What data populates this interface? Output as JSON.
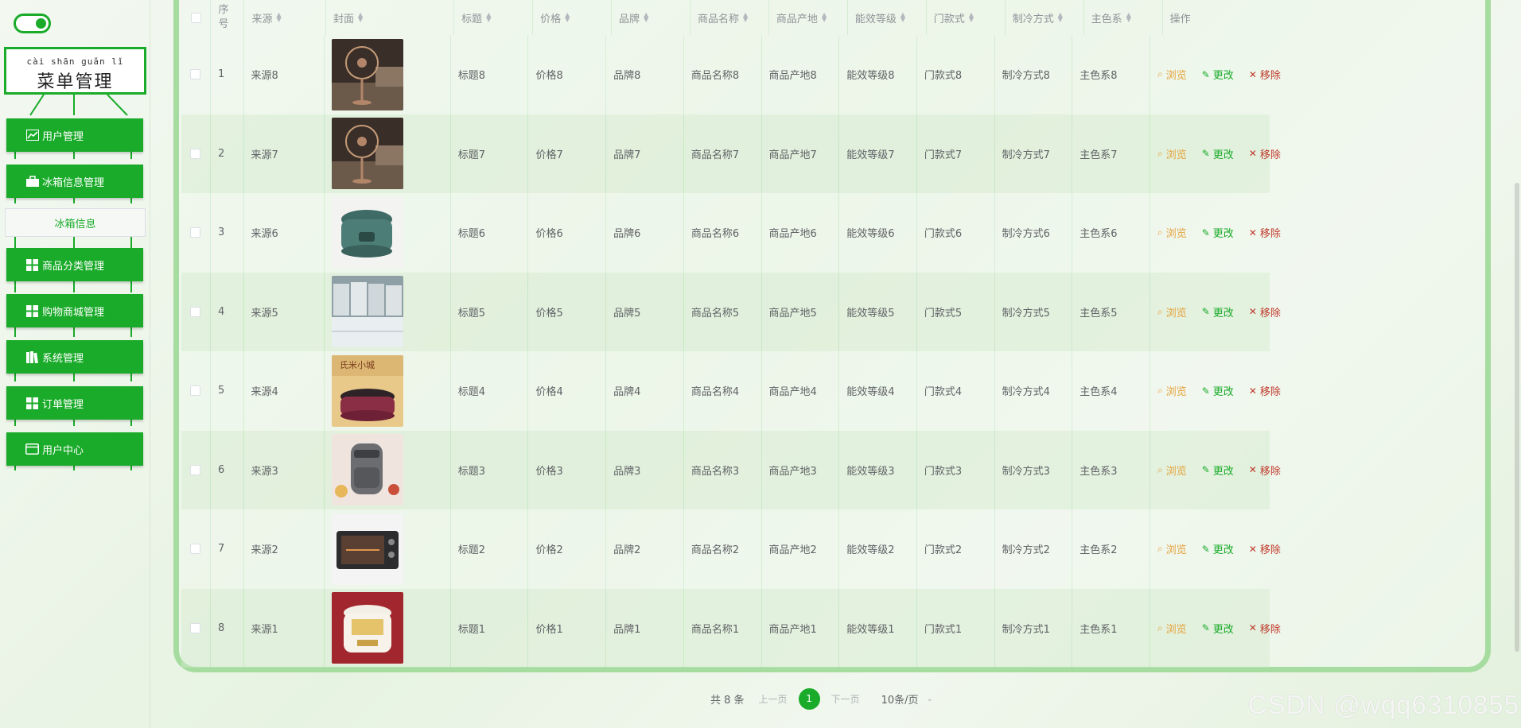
{
  "sidebar": {
    "menu_title_pinyin": "cài shān guǎn lǐ",
    "menu_title": "菜单管理",
    "items": [
      {
        "label": "用户管理",
        "icon": "chart-line-icon"
      },
      {
        "label": "冰箱信息管理",
        "icon": "briefcase-icon"
      },
      {
        "label": "冰箱信息",
        "sub": true
      },
      {
        "label": "商品分类管理",
        "icon": "grid-icon"
      },
      {
        "label": "购物商城管理",
        "icon": "grid-icon"
      },
      {
        "label": "系统管理",
        "icon": "book-icon"
      },
      {
        "label": "订单管理",
        "icon": "grid-icon"
      },
      {
        "label": "用户中心",
        "icon": "wallet-icon"
      }
    ]
  },
  "table": {
    "headers": {
      "index": "序号",
      "source": "来源",
      "cover": "封面",
      "title": "标题",
      "price": "价格",
      "brand": "品牌",
      "name": "商品名称",
      "origin": "商品产地",
      "level": "能效等级",
      "door": "门款式",
      "cooling": "制冷方式",
      "color": "主色系",
      "ops": "操作"
    },
    "ops_labels": {
      "view": "浏览",
      "edit": "更改",
      "delete": "移除"
    },
    "rows": [
      {
        "index": "1",
        "source": "来源8",
        "cover": "fan",
        "title": "标题8",
        "price": "价格8",
        "brand": "品牌8",
        "name": "商品名称8",
        "origin": "商品产地8",
        "level": "能效等级8",
        "door": "门款式8",
        "cooling": "制冷方式8",
        "color": "主色系8"
      },
      {
        "index": "2",
        "source": "来源7",
        "cover": "fan",
        "title": "标题7",
        "price": "价格7",
        "brand": "品牌7",
        "name": "商品名称7",
        "origin": "商品产地7",
        "level": "能效等级7",
        "door": "门款式7",
        "cooling": "制冷方式7",
        "color": "主色系7"
      },
      {
        "index": "3",
        "source": "来源6",
        "cover": "rice-cooker-teal",
        "title": "标题6",
        "price": "价格6",
        "brand": "品牌6",
        "name": "商品名称6",
        "origin": "商品产地6",
        "level": "能效等级6",
        "door": "门款式6",
        "cooling": "制冷方式6",
        "color": "主色系6"
      },
      {
        "index": "4",
        "source": "来源5",
        "cover": "fridges",
        "title": "标题5",
        "price": "价格5",
        "brand": "品牌5",
        "name": "商品名称5",
        "origin": "商品产地5",
        "level": "能效等级5",
        "door": "门款式5",
        "cooling": "制冷方式5",
        "color": "主色系5"
      },
      {
        "index": "5",
        "source": "来源4",
        "cover": "rice-cooker-red",
        "title": "标题4",
        "price": "价格4",
        "brand": "品牌4",
        "name": "商品名称4",
        "origin": "商品产地4",
        "level": "能效等级4",
        "door": "门款式4",
        "cooling": "制冷方式4",
        "color": "主色系4"
      },
      {
        "index": "6",
        "source": "来源3",
        "cover": "air-fryer",
        "title": "标题3",
        "price": "价格3",
        "brand": "品牌3",
        "name": "商品名称3",
        "origin": "商品产地3",
        "level": "能效等级3",
        "door": "门款式3",
        "cooling": "制冷方式3",
        "color": "主色系3"
      },
      {
        "index": "7",
        "source": "来源2",
        "cover": "oven",
        "title": "标题2",
        "price": "价格2",
        "brand": "品牌2",
        "name": "商品名称2",
        "origin": "商品产地2",
        "level": "能效等级2",
        "door": "门款式2",
        "cooling": "制冷方式2",
        "color": "主色系2"
      },
      {
        "index": "8",
        "source": "来源1",
        "cover": "rice-cooker-white",
        "title": "标题1",
        "price": "价格1",
        "brand": "品牌1",
        "name": "商品名称1",
        "origin": "商品产地1",
        "level": "能效等级1",
        "door": "门款式1",
        "cooling": "制冷方式1",
        "color": "主色系1"
      }
    ]
  },
  "pagination": {
    "total": "共 8 条",
    "prev": "上一页",
    "current": "1",
    "next": "下一页",
    "page_size": "10条/页"
  },
  "watermark": "CSDN @wqq6310855",
  "colors": {
    "accent": "#1aab2a",
    "view": "#e6a23c",
    "delete": "#c0392b"
  }
}
